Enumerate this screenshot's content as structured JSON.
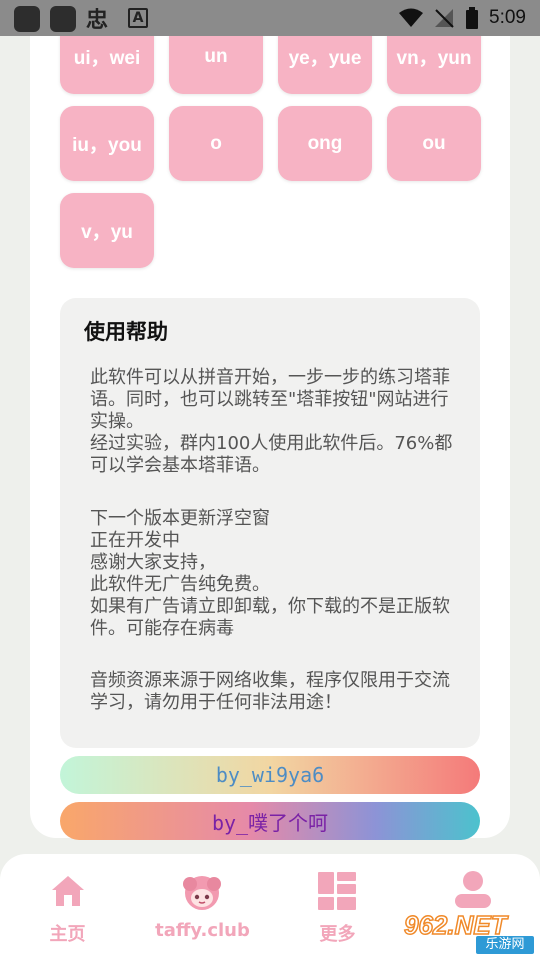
{
  "status_bar": {
    "time": "5:09",
    "left_glyph": "忠",
    "app_glyph": "A",
    "icons": [
      "app-square-icon",
      "app-square-icon",
      "wifi-icon",
      "signal-off-icon",
      "battery-icon"
    ]
  },
  "pinyin_buttons": [
    "ui，wei",
    "un",
    "ye，yue",
    "vn，yun",
    "iu，you",
    "o",
    "ong",
    "ou",
    "v，yu"
  ],
  "help": {
    "title": "使用帮助",
    "para1": "此软件可以从拼音开始，一步一步的练习塔菲语。同时，也可以跳转至\"塔菲按钮\"网站进行实操。\n经过实验，群内100人使用此软件后。76%都可以学会基本塔菲语。",
    "para2": "下一个版本更新浮空窗\n正在开发中\n感谢大家支持，\n此软件无广告纯免费。\n如果有广告请立即卸载，你下载的不是正版软件。可能存在病毒",
    "para3": "音频资源来源于网络收集，程序仅限用于交流学习，请勿用于任何非法用途！"
  },
  "credits": {
    "line1": "by_wi9ya6",
    "line2": "by_噗了个呵"
  },
  "nav": {
    "items": [
      {
        "label": "主页",
        "icon": "home-icon"
      },
      {
        "label": "taffy.club",
        "icon": "taffy-avatar-icon"
      },
      {
        "label": "更多",
        "icon": "grid-icon"
      },
      {
        "label": "",
        "icon": "profile-icon"
      }
    ]
  },
  "watermark": {
    "main": "962.NET",
    "sub": "乐游网"
  },
  "colors": {
    "button_pink": "#f7b3c4",
    "nav_pink": "#f2a6ba",
    "background": "#eef0ec"
  }
}
